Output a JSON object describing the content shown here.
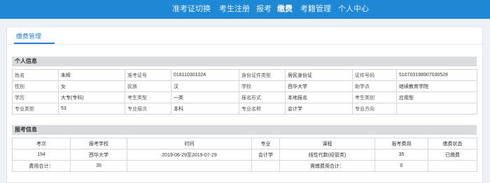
{
  "nav": {
    "items": [
      {
        "label": "准考证切换",
        "active": false
      },
      {
        "label": "考生注册",
        "active": false
      },
      {
        "label": "报考",
        "active": false
      },
      {
        "label": "缴费",
        "active": true
      },
      {
        "label": "考籍管理",
        "active": false
      },
      {
        "label": "个人中心",
        "active": false
      }
    ]
  },
  "page": {
    "tab_label": "缴费管理"
  },
  "personal": {
    "title": "个人信息",
    "rows": [
      [
        [
          "姓名",
          "朱辉"
        ],
        [
          "准考证号",
          "018110301024"
        ],
        [
          "身份证件类型",
          "居民身份证"
        ],
        [
          "证件号码",
          "510703198907030528"
        ]
      ],
      [
        [
          "性别",
          "女"
        ],
        [
          "民族",
          "汉"
        ],
        [
          "学校",
          "西华大学"
        ],
        [
          "助学点",
          "继续教育学院"
        ]
      ],
      [
        [
          "学历",
          "大专(专科)"
        ],
        [
          "考生类型",
          "一类"
        ],
        [
          "报名形式",
          "本地报名"
        ],
        [
          "考生类别",
          "应用型"
        ]
      ],
      [
        [
          "专业类型",
          "53"
        ],
        [
          "专业层次",
          "本科"
        ],
        [
          "专业名称",
          "会计学"
        ],
        [
          "专业方向",
          ""
        ]
      ]
    ]
  },
  "registration": {
    "title": "报考信息",
    "headers": [
      "考次",
      "报考学校",
      "时间",
      "专业",
      "课程",
      "报考费用",
      "缴费状态"
    ],
    "rows": [
      [
        "194",
        "西华大学",
        "2019-06-29至2019-07-29",
        "会计学",
        "线性代数(经管类)",
        "35",
        "已缴费"
      ]
    ],
    "total_label": "费用合计：",
    "total_value": "35",
    "need_label": "需缴费用合计：",
    "need_value": "0"
  }
}
